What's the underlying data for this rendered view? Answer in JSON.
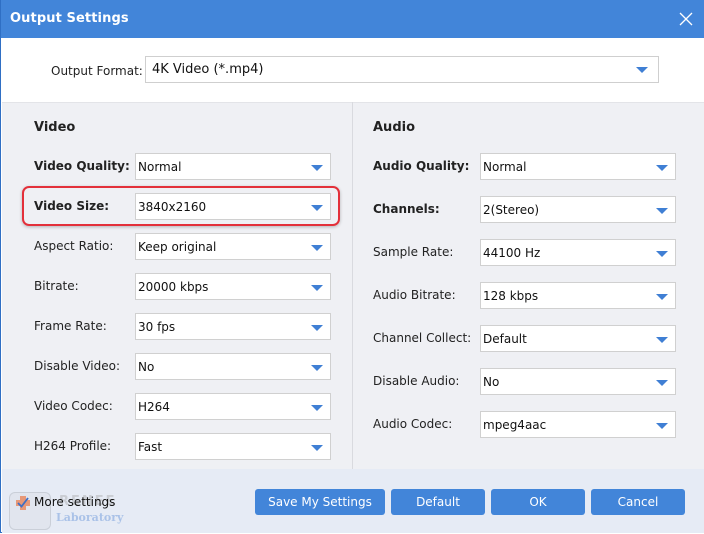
{
  "window": {
    "title": "Output Settings"
  },
  "output_format": {
    "label": "Output Format:",
    "value": "4K Video (*.mp4)"
  },
  "video": {
    "title": "Video",
    "rows": [
      {
        "label": "Video Quality:",
        "value": "Normal",
        "bold": true
      },
      {
        "label": "Video Size:",
        "value": "3840x2160",
        "bold": true,
        "highlighted": true
      },
      {
        "label": "Aspect Ratio:",
        "value": "Keep original"
      },
      {
        "label": "Bitrate:",
        "value": "20000 kbps"
      },
      {
        "label": "Frame Rate:",
        "value": "30 fps"
      },
      {
        "label": "Disable Video:",
        "value": "No"
      },
      {
        "label": "Video Codec:",
        "value": "H264"
      },
      {
        "label": "H264 Profile:",
        "value": "Fast"
      }
    ]
  },
  "audio": {
    "title": "Audio",
    "rows": [
      {
        "label": "Audio Quality:",
        "value": "Normal",
        "bold": true
      },
      {
        "label": "Channels:",
        "value": "2(Stereo)",
        "bold": true
      },
      {
        "label": "Sample Rate:",
        "value": "44100 Hz"
      },
      {
        "label": "Audio Bitrate:",
        "value": "128 kbps"
      },
      {
        "label": "Channel Collect:",
        "value": "Default"
      },
      {
        "label": "Disable Audio:",
        "value": "No"
      },
      {
        "label": "Audio Codec:",
        "value": "mpeg4aac"
      }
    ]
  },
  "footer": {
    "more_settings": {
      "label": "More settings",
      "checked": true
    },
    "buttons": {
      "save": "Save My Settings",
      "default": "Default",
      "ok": "OK",
      "cancel": "Cancel"
    },
    "watermark": {
      "top": "RENEE",
      "bottom": "Laboratory"
    }
  },
  "colors": {
    "titlebar": "#4285d9",
    "accent": "#3f7fd4",
    "highlight_border": "#e3303a",
    "panel_bg": "#eff0f4",
    "footer_bg": "#e6ebf5"
  }
}
